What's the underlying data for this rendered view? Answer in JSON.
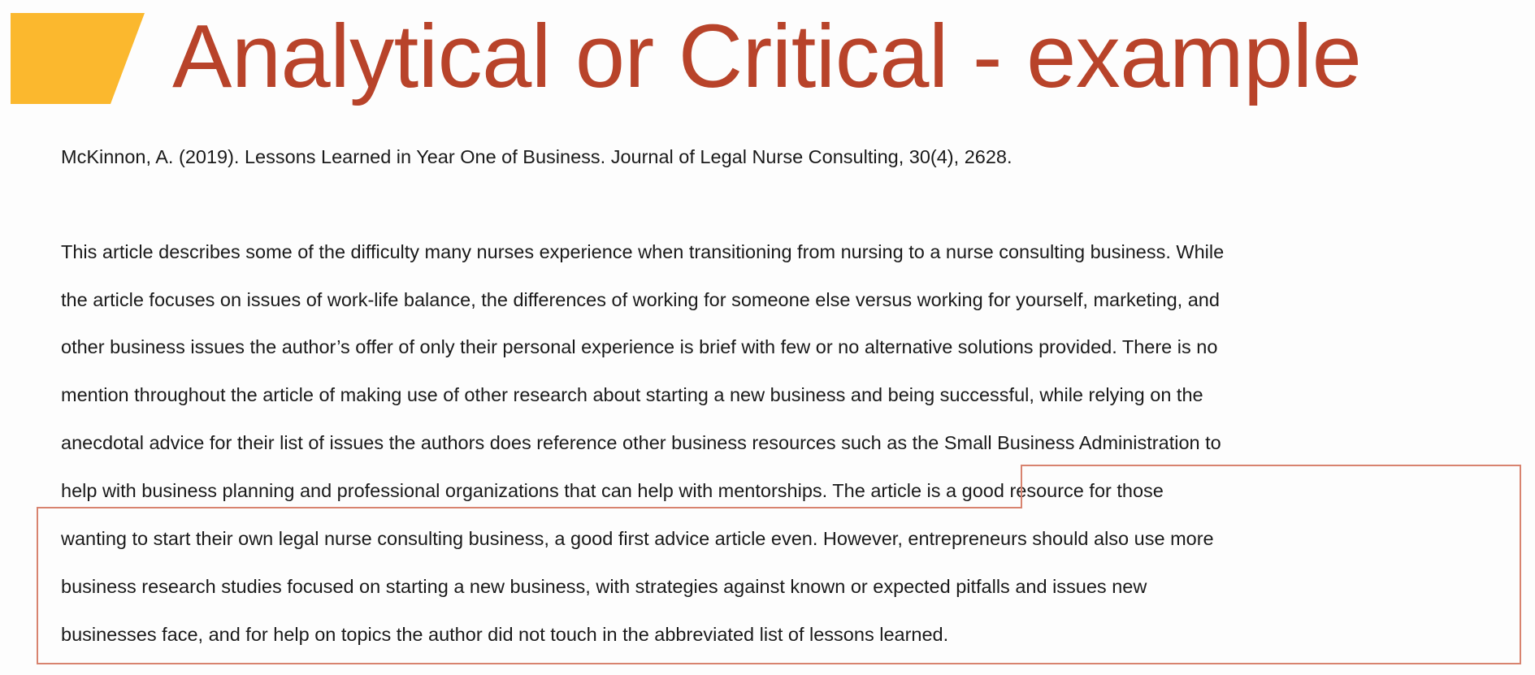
{
  "slide": {
    "title": "Analytical or Critical - example",
    "citation": "McKinnon, A. (2019). Lessons Learned in Year One of Business. Journal of Legal Nurse Consulting, 30(4), 2628.",
    "paragraph_lines": [
      "This article describes some of the difficulty many nurses experience when transitioning from nursing to a nurse consulting business. While",
      "the article focuses on issues of work-life balance, the differences of working for someone else versus working for yourself, marketing, and",
      "other business issues the author’s offer of only their personal experience is brief with few or no alternative solutions provided. There is no",
      "mention throughout the article of making use of other research about starting a new business and being successful, while relying on the",
      "anecdotal advice for their list of issues the authors does reference other business resources such as the Small Business Administration to",
      "help with business planning and professional organizations that can help with mentorships.",
      "wanting to start their own legal nurse consulting business, a good first advice article even. However, entrepreneurs should also use more",
      "business research studies focused on starting a new business, with strategies against known or expected pitfalls and issues new",
      "businesses face, and for help on topics the author did not touch in the abbreviated list of lessons learned."
    ],
    "highlight_start": " The article is a good resource for those"
  },
  "colors": {
    "title": "#b8432a",
    "accent": "#fbb82e",
    "highlight_border": "#d8836f",
    "body_text": "#1a1a1a"
  }
}
